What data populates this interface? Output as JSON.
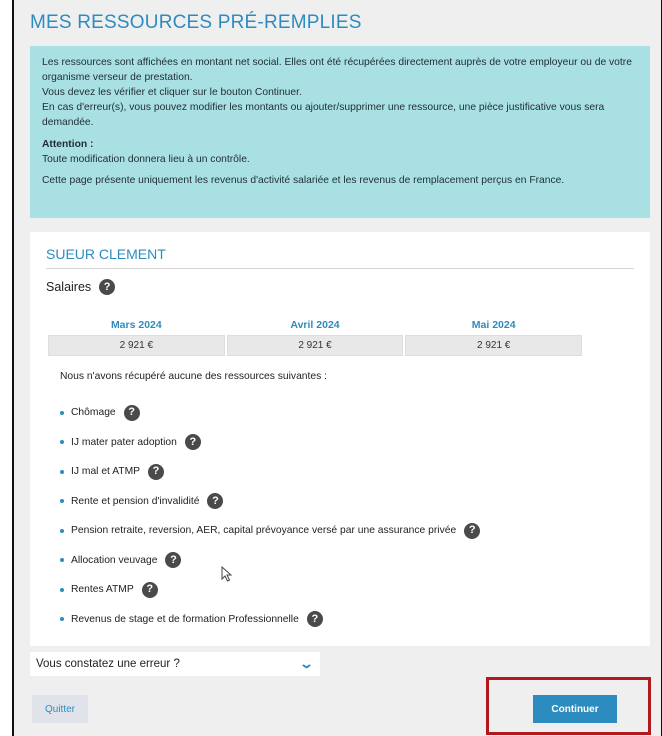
{
  "page": {
    "title": "MES RESSOURCES PRÉ-REMPLIES"
  },
  "info": {
    "line1": "Les ressources sont affichées en montant net social. Elles ont été récupérées directement auprès de votre employeur ou de votre organisme verseur de prestation.",
    "line2": "Vous devez les vérifier et cliquer sur le bouton Continuer.",
    "line3": "En cas d'erreur(s), vous pouvez modifier les montants ou ajouter/supprimer une ressource, une pièce justificative vous sera demandée.",
    "attention_label": "Attention :",
    "attention_text": "Toute modification donnera lieu à un contrôle.",
    "scope_text": "Cette page présente uniquement les revenus d'activité salariée et les revenus de remplacement perçus en France."
  },
  "person": {
    "name": "SUEUR CLEMENT"
  },
  "salaries": {
    "title": "Salaires",
    "months": [
      {
        "label": "Mars 2024",
        "value": "2 921 €"
      },
      {
        "label": "Avril 2024",
        "value": "2 921 €"
      },
      {
        "label": "Mai 2024",
        "value": "2 921 €"
      }
    ]
  },
  "missing": {
    "intro": "Nous n'avons récupéré aucune des ressources suivantes :",
    "items": [
      "Chômage",
      "IJ mater pater adoption",
      "IJ mal et ATMP",
      "Rente et pension d'invalidité",
      "Pension retraite, reversion, AER, capital prévoyance versé par une assurance privée",
      "Allocation veuvage",
      "Rentes ATMP",
      "Revenus de stage et de formation Professionnelle"
    ]
  },
  "help_glyph": "?",
  "error": {
    "label": "Vous constatez une erreur ?",
    "chevron": "⌄"
  },
  "buttons": {
    "quit": "Quitter",
    "continue": "Continuer"
  },
  "colors": {
    "accent": "#2d8cbf",
    "info_bg": "#a8e0e4",
    "highlight": "#b3191c"
  }
}
